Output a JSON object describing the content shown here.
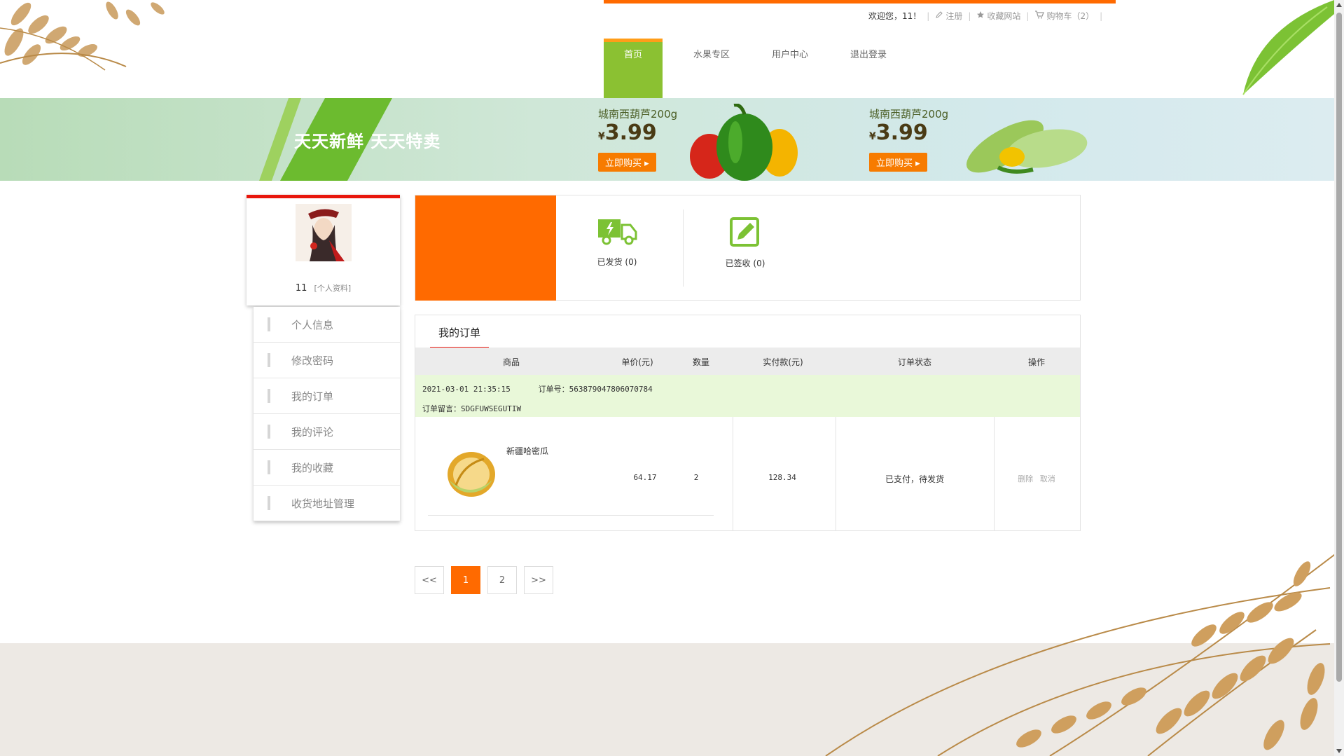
{
  "header": {
    "welcome": "欢迎您，11！",
    "register": "注册",
    "favorite_site": "收藏网站",
    "cart": "购物车（2）",
    "separator": "|"
  },
  "nav": {
    "items": [
      {
        "label": "首页"
      },
      {
        "label": "水果专区"
      },
      {
        "label": "用户中心"
      },
      {
        "label": "退出登录"
      }
    ]
  },
  "banner": {
    "slogan": "天天新鲜  天天特卖",
    "promos": [
      {
        "title": "城南西葫芦200g",
        "currency": "¥",
        "price": "3.99",
        "button": "立即购买 ▸"
      },
      {
        "title": "城南西葫芦200g",
        "currency": "¥",
        "price": "3.99",
        "button": "立即购买 ▸"
      }
    ]
  },
  "profile": {
    "name": "11",
    "profile_link": "[个人资料]"
  },
  "sidebar": {
    "items": [
      {
        "label": "个人信息"
      },
      {
        "label": "修改密码"
      },
      {
        "label": "我的订单"
      },
      {
        "label": "我的评论"
      },
      {
        "label": "我的收藏"
      },
      {
        "label": "收货地址管理"
      }
    ]
  },
  "status": {
    "shipped": "已发货 (0)",
    "received": "已签收 (0)"
  },
  "orders": {
    "tab": "我的订单",
    "columns": [
      "商品",
      "单价(元)",
      "数量",
      "实付款(元)",
      "订单状态",
      "操作"
    ],
    "list": [
      {
        "datetime": "2021-03-01 21:35:15",
        "order_no_label": "订单号：",
        "order_no": "563879047806070784",
        "remark_label": "订单留言：",
        "remark": "SDGFUWSEGUTIW",
        "product": "新疆哈密瓜",
        "unit_price": "64.17",
        "quantity": "2",
        "paid": "128.34",
        "state": "已支付，待发货",
        "op_delete": "删除",
        "op_cancel": "取消"
      }
    ]
  },
  "pager": {
    "prev": "<<",
    "pages": [
      "1",
      "2"
    ],
    "current": "1",
    "next": ">>"
  },
  "colors": {
    "accent_orange": "#ff6a00",
    "nav_green": "#8bc132",
    "red": "#e8160c",
    "order_meta_bg": "#e9f8d9"
  }
}
